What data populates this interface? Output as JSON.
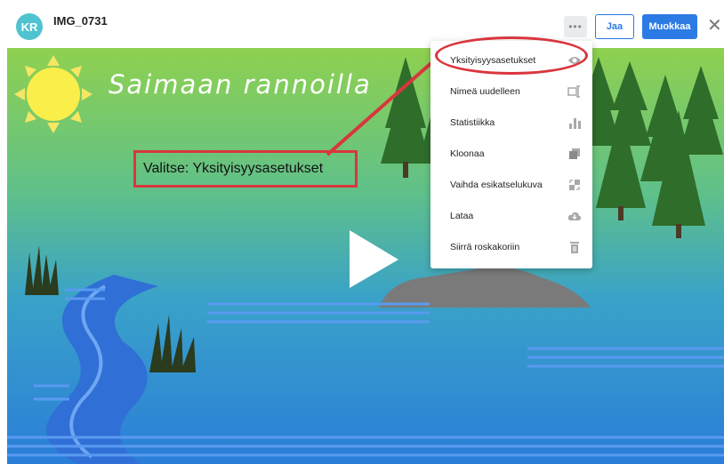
{
  "header": {
    "avatar_initials": "KR",
    "title": "IMG_0731",
    "more_label": "•••",
    "share_label": "Jaa",
    "edit_label": "Muokkaa",
    "close_label": "✕"
  },
  "scene": {
    "title": "Saimaan rannoilla"
  },
  "annotation": {
    "text": "Valitse: Yksityisyysasetukset"
  },
  "menu": {
    "items": [
      {
        "label": "Yksityisyysasetukset",
        "icon": "eye-icon"
      },
      {
        "label": "Nimeä uudelleen",
        "icon": "rename-icon"
      },
      {
        "label": "Statistiikka",
        "icon": "bar-chart-icon"
      },
      {
        "label": "Kloonaa",
        "icon": "clone-icon"
      },
      {
        "label": "Vaihda esikatselukuva",
        "icon": "swap-thumbnail-icon"
      },
      {
        "label": "Lataa",
        "icon": "cloud-download-icon"
      },
      {
        "label": "Siirrä roskakoriin",
        "icon": "trash-icon"
      }
    ]
  },
  "colors": {
    "accent": "#2c7be5",
    "avatar": "#4fc3d0",
    "annotation": "#d9363e"
  }
}
